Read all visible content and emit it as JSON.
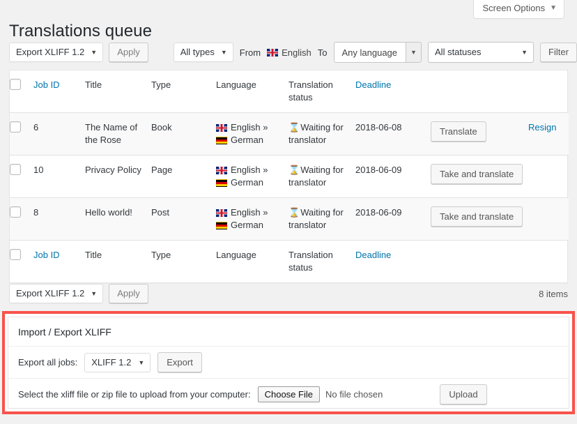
{
  "screen_options": {
    "label": "Screen Options",
    "caret": "▼"
  },
  "header": {
    "title": "Translations queue"
  },
  "toolbar_top": {
    "bulk_action": "Export XLIFF 1.2",
    "apply_label": "Apply",
    "type_filter": "All types",
    "from_label": "From",
    "from_language": "English",
    "to_label": "To",
    "to_language": "Any language",
    "status_filter": "All statuses",
    "filter_label": "Filter",
    "caret": "▼"
  },
  "table": {
    "columns": [
      {
        "key": "checkbox",
        "label": ""
      },
      {
        "key": "job_id",
        "label": "Job ID",
        "link": true
      },
      {
        "key": "title",
        "label": "Title",
        "link": false
      },
      {
        "key": "type",
        "label": "Type",
        "link": false
      },
      {
        "key": "language",
        "label": "Language",
        "link": false
      },
      {
        "key": "status",
        "label": "Translation status",
        "link": false
      },
      {
        "key": "deadline",
        "label": "Deadline",
        "link": true
      },
      {
        "key": "action",
        "label": "",
        "link": false
      },
      {
        "key": "extra",
        "label": "",
        "link": false
      }
    ],
    "rows": [
      {
        "job_id": "6",
        "title": "The Name of the Rose",
        "type": "Book",
        "source_lang": "English »",
        "target_lang": "German",
        "source_flag": "flag-gb-icon",
        "target_flag": "flag-de-icon",
        "status_icon": "⌛",
        "status": "Waiting for translator",
        "deadline": "2018-06-08",
        "action_label": "Translate",
        "extra_link": "Resign"
      },
      {
        "job_id": "10",
        "title": "Privacy Policy",
        "type": "Page",
        "source_lang": "English »",
        "target_lang": "German",
        "source_flag": "flag-gb-icon",
        "target_flag": "flag-de-icon",
        "status_icon": "⌛",
        "status": "Waiting for translator",
        "deadline": "2018-06-09",
        "action_label": "Take and translate",
        "extra_link": ""
      },
      {
        "job_id": "8",
        "title": "Hello world!",
        "type": "Post",
        "source_lang": "English »",
        "target_lang": "German",
        "source_flag": "flag-gb-icon",
        "target_flag": "flag-de-icon",
        "status_icon": "⌛",
        "status": "Waiting for translator",
        "deadline": "2018-06-09",
        "action_label": "Take and translate",
        "extra_link": ""
      }
    ]
  },
  "toolbar_bottom": {
    "bulk_action": "Export XLIFF 1.2",
    "apply_label": "Apply",
    "items_count": "8 items",
    "caret": "▼"
  },
  "import_export": {
    "panel_title": "Import / Export XLIFF",
    "export_label": "Export all jobs:",
    "export_format": "XLIFF 1.2",
    "export_button": "Export",
    "upload_label": "Select the xliff file or zip file to upload from your computer:",
    "choose_file_button": "Choose File",
    "no_file_text": "No file chosen",
    "upload_button": "Upload",
    "caret": "▼",
    "highlight_color": "#f8534b"
  }
}
